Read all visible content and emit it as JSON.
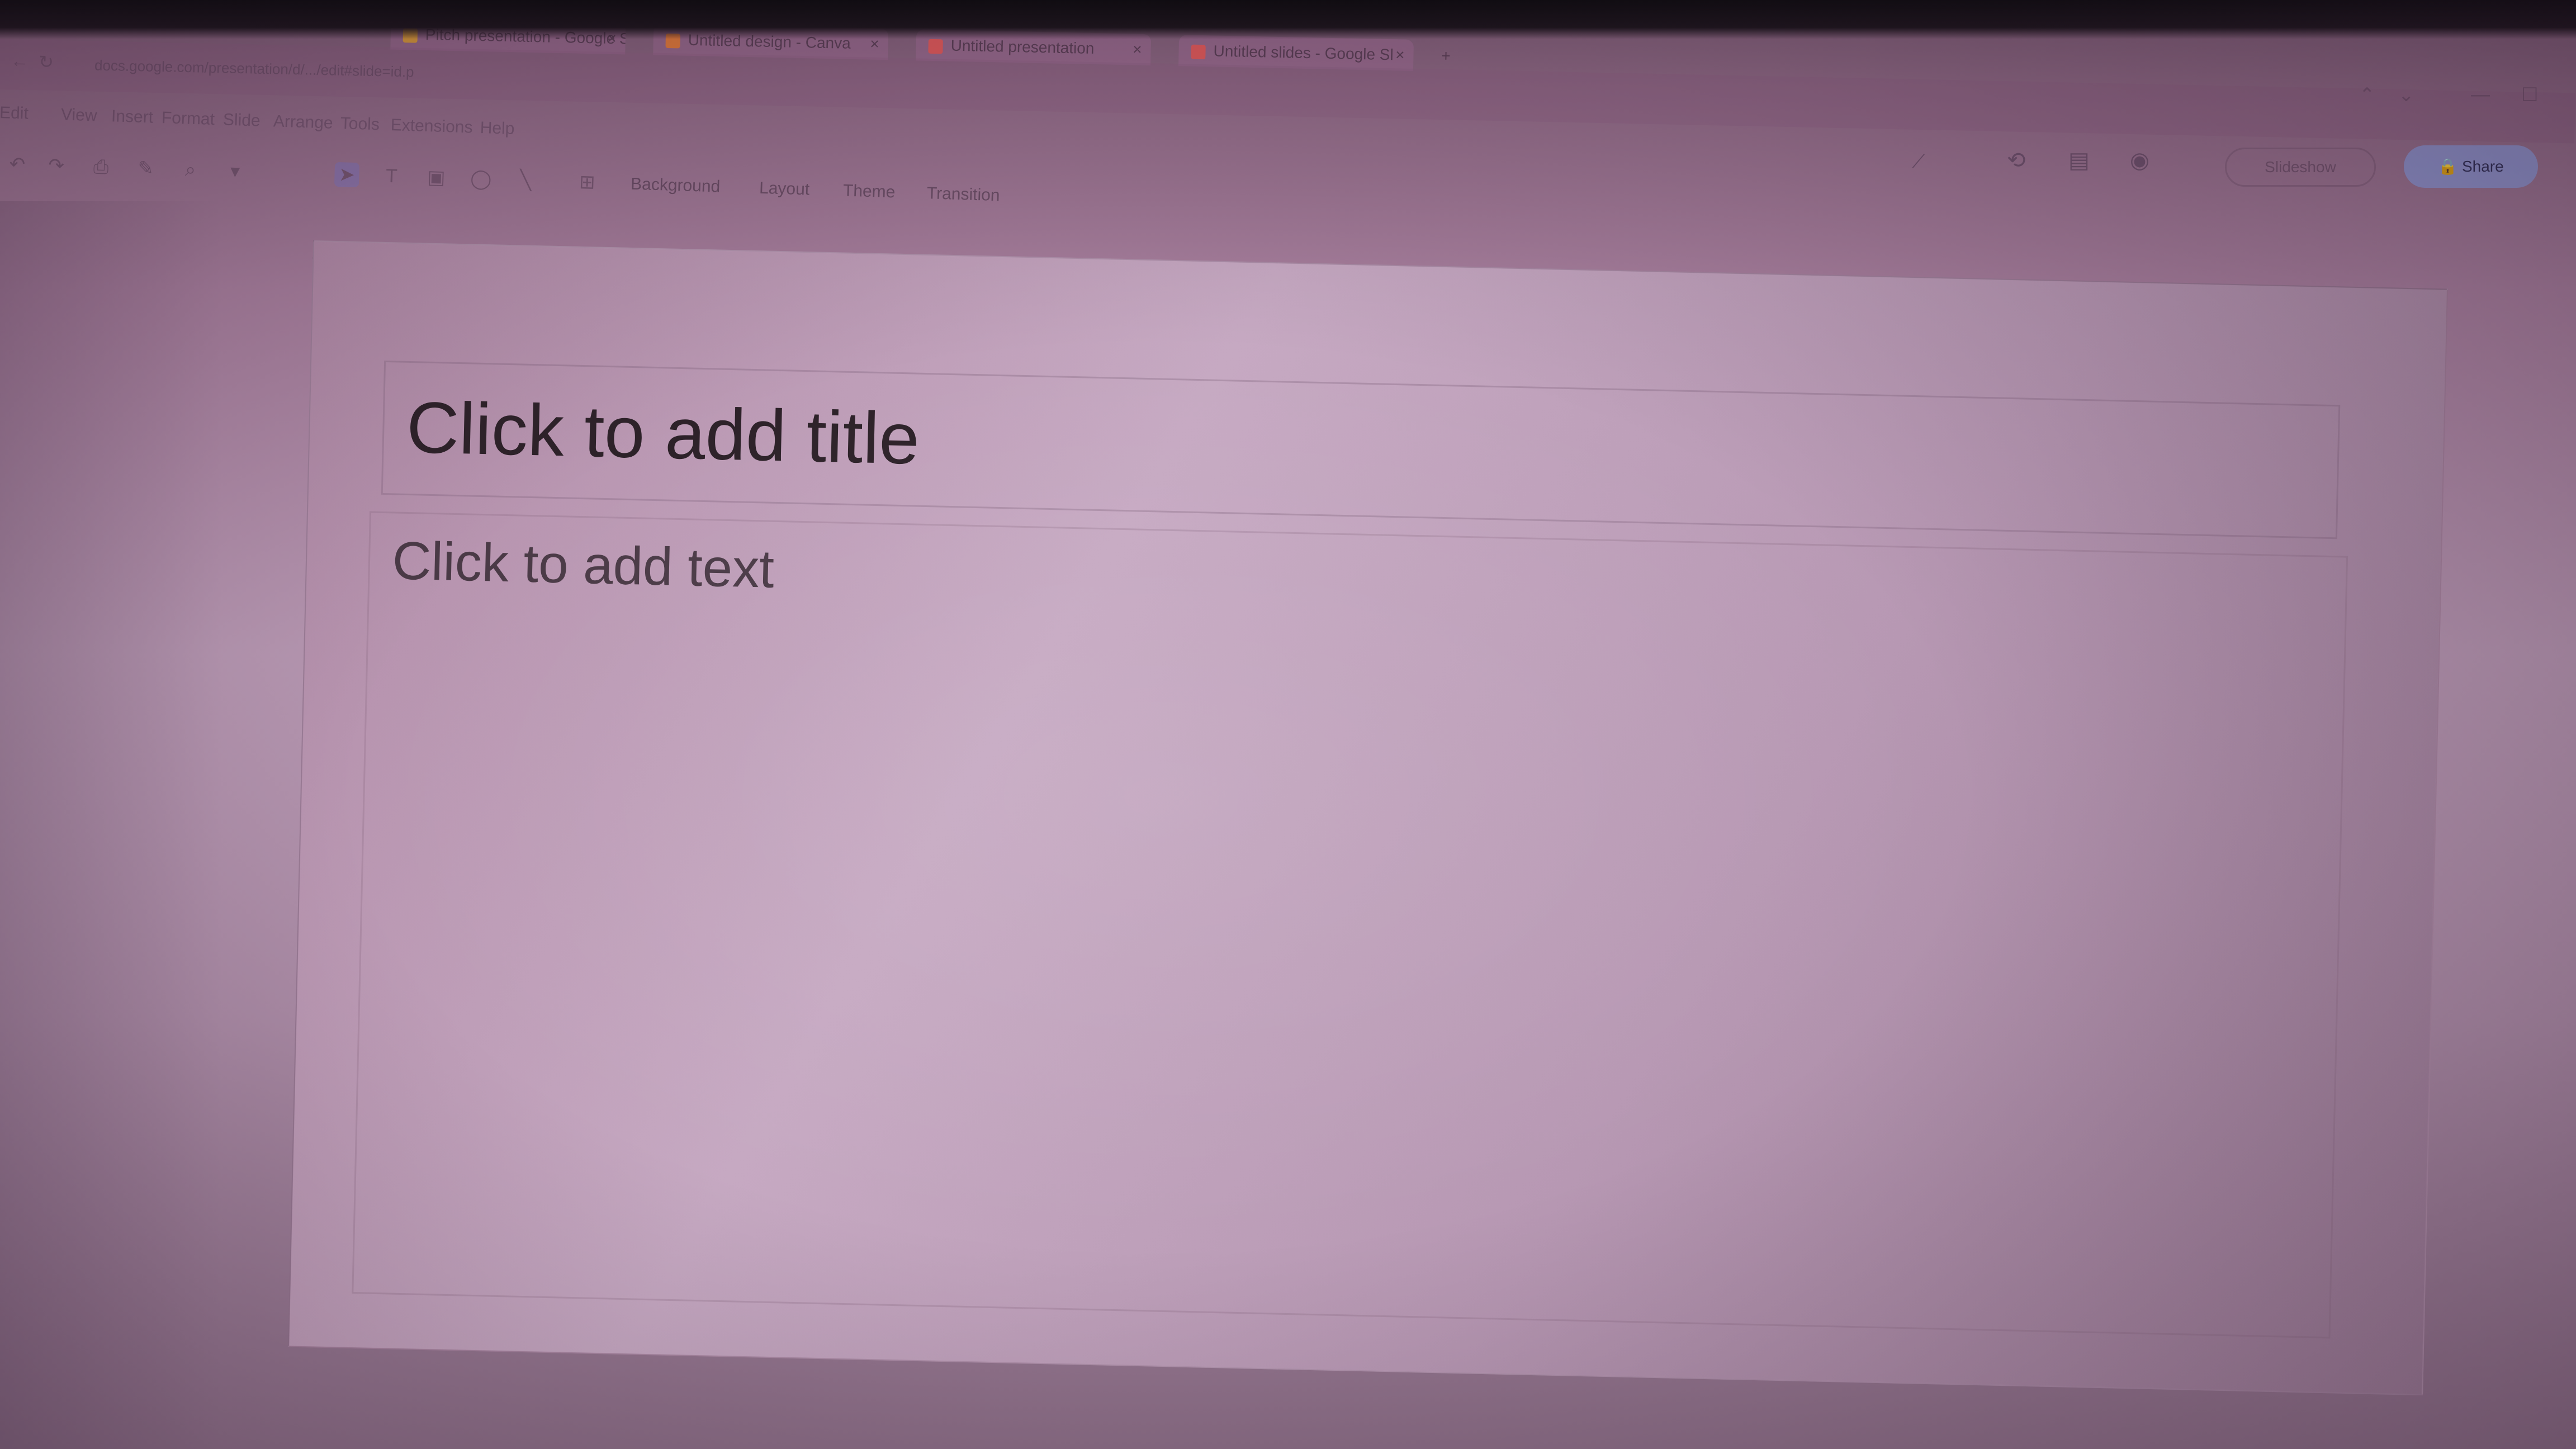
{
  "browser": {
    "tabs": [
      {
        "label": "Pitch presentation - Google Sl"
      },
      {
        "label": "Untitled design - Canva"
      },
      {
        "label": "Untitled presentation"
      },
      {
        "label": "Untitled slides - Google Sl"
      }
    ],
    "address": "docs.google.com/presentation/d/.../edit#slide=id.p"
  },
  "menu": {
    "items": [
      "Edit",
      "View",
      "Insert",
      "Format",
      "Slide",
      "Arrange",
      "Tools",
      "Extensions",
      "Help"
    ]
  },
  "toolbar": {
    "background_label": "Background",
    "layout_label": "Layout",
    "theme_label": "Theme",
    "transition_label": "Transition",
    "icons": [
      "undo-icon",
      "redo-icon",
      "print-icon",
      "paint-format-icon",
      "zoom-icon",
      "select-icon",
      "text-box-icon",
      "image-icon",
      "shape-icon",
      "line-icon",
      "comment-icon"
    ]
  },
  "header_right": {
    "slideshow_label": "Slideshow",
    "share_label": "Share"
  },
  "slide": {
    "title_placeholder": "Click to add title",
    "body_placeholder": "Click to add text"
  },
  "colors": {
    "accent": "#8ca0e1",
    "active_tool": "#6e78dc"
  }
}
